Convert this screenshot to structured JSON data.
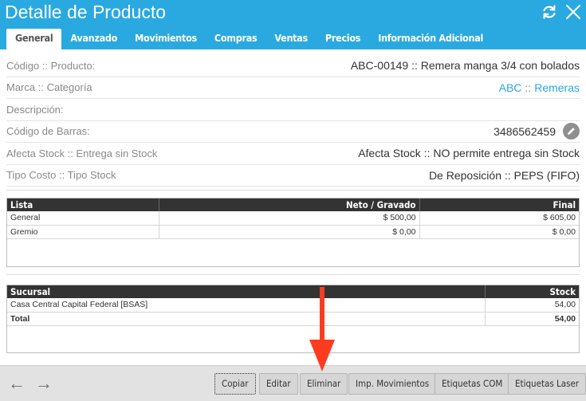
{
  "header": {
    "title": "Detalle de Producto",
    "color": "#29a9e0",
    "icons": [
      "refresh-icon",
      "close-icon"
    ]
  },
  "tabs": [
    {
      "label": "General",
      "active": true
    },
    {
      "label": "Avanzado",
      "active": false
    },
    {
      "label": "Movimientos",
      "active": false
    },
    {
      "label": "Compras",
      "active": false
    },
    {
      "label": "Ventas",
      "active": false
    },
    {
      "label": "Precios",
      "active": false
    },
    {
      "label": "Información Adicional",
      "active": false
    }
  ],
  "info": {
    "codigo_label": "Código :: Producto:",
    "codigo_value": "ABC-00149 :: Remera manga 3/4 con bolados",
    "marca_label": "Marca :: Categoría",
    "marca_value": "ABC",
    "categoria_value": "Remeras",
    "sep": "::",
    "descripcion_label": "Descripción:",
    "barras_label": "Código de Barras:",
    "barras_value": "3486562459",
    "stock_label": "Afecta Stock :: Entrega sin Stock",
    "stock_value": "Afecta Stock :: NO permite entrega sin Stock",
    "costo_label": "Tipo Costo :: Tipo Stock",
    "costo_value": "De Reposición :: PEPS (FIFO)"
  },
  "prices_table": {
    "headers": [
      "Lista",
      "Neto / Gravado",
      "Final"
    ],
    "rows": [
      [
        "General",
        "$ 500,00",
        "$ 605,00"
      ],
      [
        "Gremio",
        "$ 0,00",
        "$ 0,00"
      ]
    ]
  },
  "stock_table": {
    "headers": [
      "Sucursal",
      "Stock"
    ],
    "rows": [
      [
        "Casa Central Capital Federal [BSAS]",
        "54,00"
      ]
    ],
    "total_label": "Total",
    "total_value": "54,00"
  },
  "footer": {
    "back_arrow": "←",
    "forward_arrow": "→",
    "buttons": [
      "Copiar",
      "Editar",
      "Eliminar",
      "Imp. Movimientos",
      "Etiquetas COM",
      "Etiquetas Laser"
    ]
  },
  "annotation": {
    "arrow_color": "#ff3b1f",
    "points_to": "Eliminar"
  }
}
